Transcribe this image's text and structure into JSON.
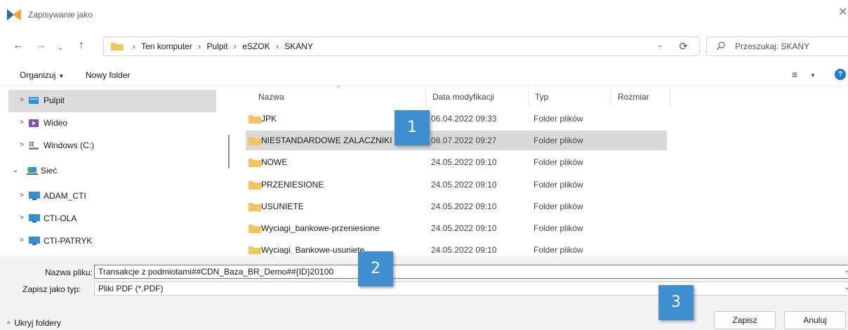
{
  "window": {
    "title": "Zapisywanie jako",
    "close_glyph": "✕"
  },
  "nav": {
    "back_glyph": "←",
    "forward_glyph": "→",
    "recent_glyph": "⌄",
    "up_glyph": "↑"
  },
  "address": {
    "crumbs": [
      "Ten komputer",
      "Pulpit",
      "eSZOK",
      "SKANY"
    ],
    "separator": "›",
    "dropdown_glyph": "⌄",
    "refresh_glyph": "⟳"
  },
  "search": {
    "placeholder": "Przeszukaj: SKANY"
  },
  "toolbar": {
    "organize_label": "Organizuj",
    "organize_caret": "▼",
    "new_folder_label": "Nowy folder",
    "view_glyph": "≡",
    "view_caret": "▼",
    "help_glyph": "?"
  },
  "sidebar": {
    "items": [
      {
        "label": "Pulpit",
        "expander": ">",
        "icon": "desktop-icon",
        "selected": true
      },
      {
        "label": "Wideo",
        "expander": ">",
        "icon": "video-icon",
        "selected": false
      },
      {
        "label": "Windows (C:)",
        "expander": ">",
        "icon": "drive-icon",
        "selected": false
      },
      {
        "label": "Sieć",
        "expander": "⌄",
        "icon": "network-icon",
        "selected": false
      },
      {
        "label": "ADAM_CTI",
        "expander": ">",
        "icon": "computer-icon",
        "selected": false
      },
      {
        "label": "CTI-OLA",
        "expander": ">",
        "icon": "computer-icon",
        "selected": false
      },
      {
        "label": "CTI-PATRYK",
        "expander": ">",
        "icon": "computer-icon",
        "selected": false
      }
    ]
  },
  "filelist": {
    "columns": {
      "name": "Nazwa",
      "date": "Data modyfikacji",
      "type": "Typ",
      "size": "Rozmiar"
    },
    "sort_glyph": "^",
    "rows": [
      {
        "name": "JPK",
        "date": "06.04.2022 09:33",
        "type": "Folder plików",
        "selected": false
      },
      {
        "name": "NIESTANDARDOWE ZALACZNIKI",
        "date": "08.07.2022 09:27",
        "type": "Folder plików",
        "selected": true
      },
      {
        "name": "NOWE",
        "date": "24.05.2022 09:10",
        "type": "Folder plików",
        "selected": false
      },
      {
        "name": "PRZENIESIONE",
        "date": "24.05.2022 09:10",
        "type": "Folder plików",
        "selected": false
      },
      {
        "name": "USUNIETE",
        "date": "24.05.2022 09:10",
        "type": "Folder plików",
        "selected": false
      },
      {
        "name": "Wyciagi_bankowe-przeniesione",
        "date": "24.05.2022 09:10",
        "type": "Folder plików",
        "selected": false
      },
      {
        "name": "Wyciagi_Bankowe-usuniete",
        "date": "24.05.2022 09:10",
        "type": "Folder plików",
        "selected": false
      }
    ]
  },
  "form": {
    "filename_label": "Nazwa pliku:",
    "filename_value": "Transakcje z podmiotami##CDN_Baza_BR_Demo##{ID}20100",
    "filetype_label": "Zapisz jako typ:",
    "filetype_value": "Pliki PDF (*.PDF)",
    "dropdown_glyph": "⌄"
  },
  "footer": {
    "hide_folders_label": "Ukryj foldery",
    "hide_folders_arrow": "^",
    "save_label": "Zapisz",
    "cancel_label": "Anuluj"
  },
  "callouts": [
    "1",
    "2",
    "3"
  ],
  "colors": {
    "folder": "#f3c55d",
    "accent": "#1b7bd6",
    "callout": "#3f8fd0",
    "selection": "#d9d9d9"
  }
}
